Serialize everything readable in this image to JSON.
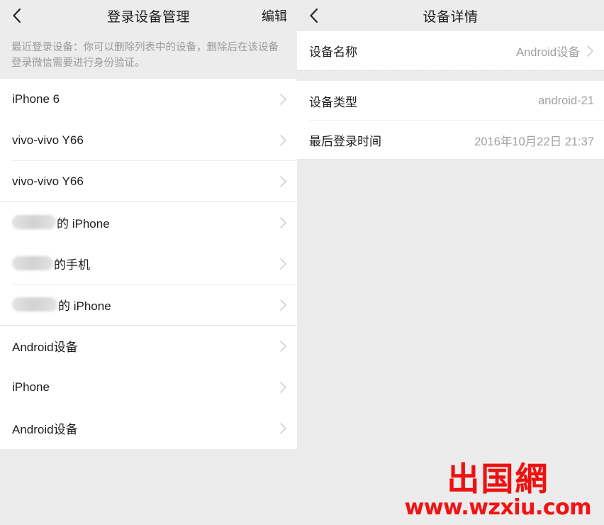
{
  "left_panel": {
    "navbar": {
      "back_icon": "chevron-left-icon",
      "title": "登录设备管理",
      "action_label": "编辑"
    },
    "description": "最近登录设备：你可以删除列表中的设备，删除后在该设备登录微信需要进行身份验证。",
    "devices": [
      {
        "name": "iPhone 6",
        "redacted": false,
        "chevron": "chevron-right-icon"
      },
      {
        "name": "vivo-vivo Y66",
        "redacted": false,
        "chevron": "chevron-right-icon"
      },
      {
        "name": "vivo-vivo Y66",
        "redacted": false,
        "chevron": "chevron-right-icon"
      },
      {
        "name": "的 iPhone",
        "redacted": true,
        "redact_width": 62,
        "chevron": "chevron-right-icon"
      },
      {
        "name": "的手机",
        "redacted": true,
        "redact_width": 58,
        "chevron": "chevron-right-icon"
      },
      {
        "name": "的 iPhone",
        "redacted": true,
        "redact_width": 64,
        "chevron": "chevron-right-icon"
      },
      {
        "name": "Android设备",
        "redacted": false,
        "chevron": "chevron-right-icon"
      },
      {
        "name": "iPhone",
        "redacted": false,
        "chevron": "chevron-right-icon"
      },
      {
        "name": "Android设备",
        "redacted": false,
        "chevron": "chevron-right-icon"
      }
    ]
  },
  "right_panel": {
    "navbar": {
      "back_icon": "chevron-left-icon",
      "title": "设备详情"
    },
    "details": [
      {
        "label": "设备名称",
        "value": "Android设备",
        "chevron": "chevron-right-icon",
        "has_chevron": true
      },
      {
        "label": "设备类型",
        "value": "android-21",
        "has_chevron": false
      },
      {
        "label": "最后登录时间",
        "value": "2016年10月22日 21:37",
        "has_chevron": false
      }
    ]
  },
  "watermark": {
    "logo_text": "出国網",
    "url_text": "www.wzxiu.com",
    "color": "#ee1111"
  },
  "colors": {
    "background": "#ececec",
    "card": "#ffffff",
    "primary_text": "#1c1c1c",
    "secondary_text": "#a0a0a0",
    "divider": "#efefef"
  }
}
